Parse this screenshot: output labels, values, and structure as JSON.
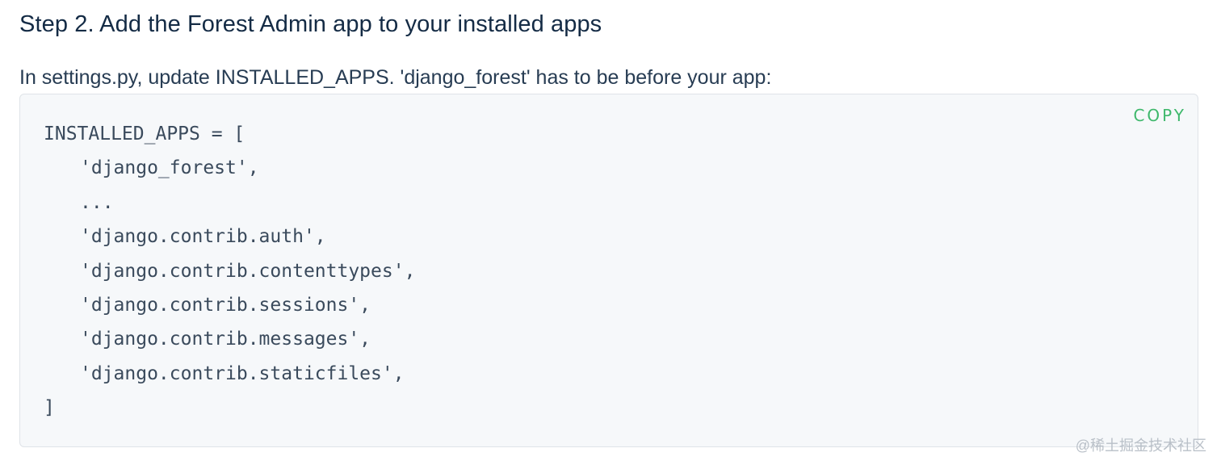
{
  "heading": "Step 2. Add the Forest Admin app to your installed apps",
  "intro": "In settings.py, update INSTALLED_APPS. 'django_forest' has to be before your app:",
  "code_block": {
    "copy_label": "COPY",
    "lines": [
      "INSTALLED_APPS = [",
      "'django_forest',",
      "...",
      "'django.contrib.auth',",
      "'django.contrib.contenttypes',",
      "'django.contrib.sessions',",
      "'django.contrib.messages',",
      "'django.contrib.staticfiles',",
      "]"
    ]
  },
  "watermark": "@稀土掘金技术社区",
  "colors": {
    "heading": "#142b45",
    "copy_accent": "#3fb86c",
    "code_background": "#f6f8fa",
    "code_text": "#3a4a5c"
  }
}
